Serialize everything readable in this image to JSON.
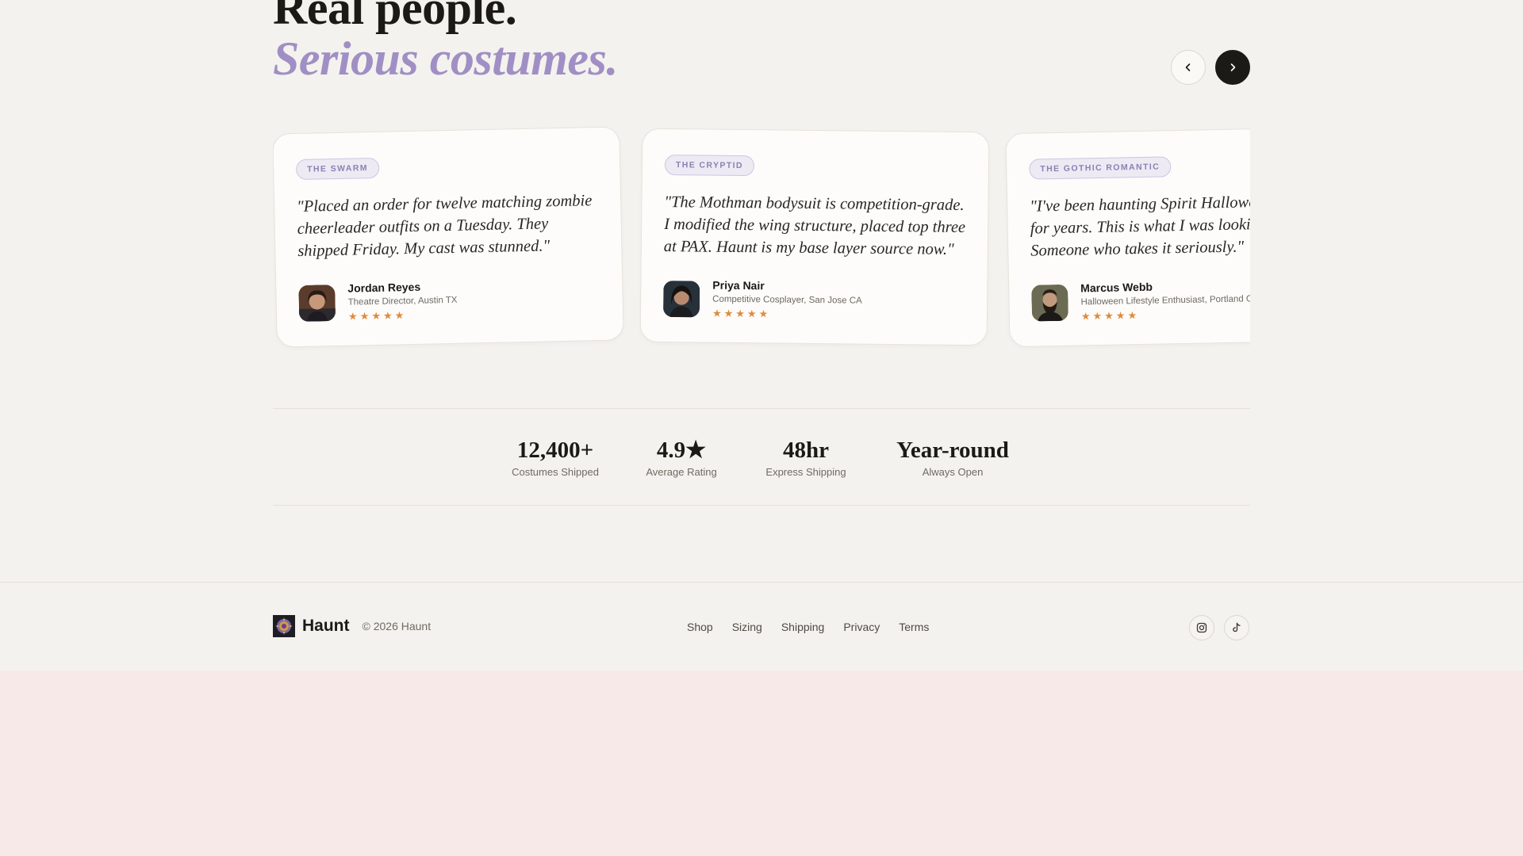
{
  "heading": {
    "line1": "Real people.",
    "line2": "Serious costumes."
  },
  "carousel": {
    "prev_icon": "chevron-left-icon",
    "next_icon": "chevron-right-icon"
  },
  "testimonials": [
    {
      "tag": "THE SWARM",
      "quote_lines": [
        "\"Placed an order for twelve matching zombie",
        "cheerleader outfits on a Tuesday. They",
        "shipped Friday. My cast was stunned.\""
      ],
      "name": "Jordan Reyes",
      "role": "Theatre Director, Austin TX",
      "stars": "★★★★★",
      "rating": 5
    },
    {
      "tag": "THE CRYPTID",
      "quote_lines": [
        "\"The Mothman bodysuit is competition-grade.",
        "I modified the wing structure, placed top three",
        "at PAX. Haunt is my base layer source now.\""
      ],
      "name": "Priya Nair",
      "role": "Competitive Cosplayer, San Jose CA",
      "stars": "★★★★★",
      "rating": 5
    },
    {
      "tag": "THE GOTHIC ROMANTIC",
      "quote_lines": [
        "\"I've been haunting Spirit Halloween stores",
        "for years. This is what I was looking for.",
        "Someone who takes it seriously.\""
      ],
      "name": "Marcus Webb",
      "role": "Halloween Lifestyle Enthusiast, Portland OR",
      "stars": "★★★★★",
      "rating": 5
    }
  ],
  "stats": [
    {
      "value": "12,400+",
      "label": "Costumes Shipped"
    },
    {
      "value": "4.9★",
      "label": "Average Rating"
    },
    {
      "value": "48hr",
      "label": "Express Shipping"
    },
    {
      "value": "Year-round",
      "label": "Always Open"
    }
  ],
  "footer": {
    "brand": "Haunt",
    "copyright": "© 2026 Haunt",
    "links": [
      "Shop",
      "Sizing",
      "Shipping",
      "Privacy",
      "Terms"
    ],
    "social": [
      "instagram-icon",
      "tiktok-icon"
    ]
  },
  "colors": {
    "accent": "#a08fc4",
    "star": "#e08a3c",
    "ink": "#1c1a17",
    "page": "#f4f2ee",
    "below_page": "#f8e9e9"
  }
}
